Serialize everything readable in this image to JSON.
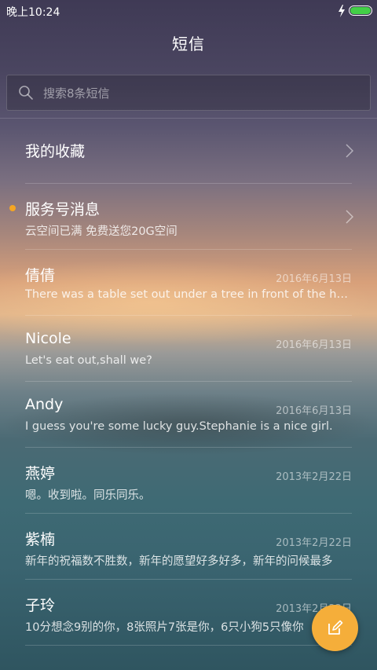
{
  "status_bar": {
    "time": "晚上10:24",
    "battery_color": "#43d047"
  },
  "header": {
    "title": "短信"
  },
  "search": {
    "placeholder": "搜索8条短信"
  },
  "favorites": {
    "label": "我的收藏"
  },
  "service": {
    "name": "服务号消息",
    "preview": "云空间已满 免费送您20G空间",
    "unread_dot_color": "#f5a623"
  },
  "conversations": [
    {
      "name": "倩倩",
      "date": "2016年6月13日",
      "preview": "There was a table set out under a tree in front of the house"
    },
    {
      "name": "Nicole",
      "date": "2016年6月13日",
      "preview": "Let's eat out,shall we?"
    },
    {
      "name": "Andy",
      "date": "2016年6月13日",
      "preview": "I guess you're some lucky guy.Stephanie is a nice girl."
    },
    {
      "name": "燕婷",
      "date": "2013年2月22日",
      "preview": "嗯。收到啦。同乐同乐。"
    },
    {
      "name": "紫楠",
      "date": "2013年2月22日",
      "preview": "新年的祝福数不胜数，新年的愿望好多好多，新年的问候最多"
    },
    {
      "name": "子玲",
      "date": "2013年2月22日",
      "preview": "10分想念9别的你，8张照片7张是你，6只小狗5只像你"
    }
  ],
  "fab": {
    "icon": "compose-icon",
    "color": "#f5ae3a"
  }
}
